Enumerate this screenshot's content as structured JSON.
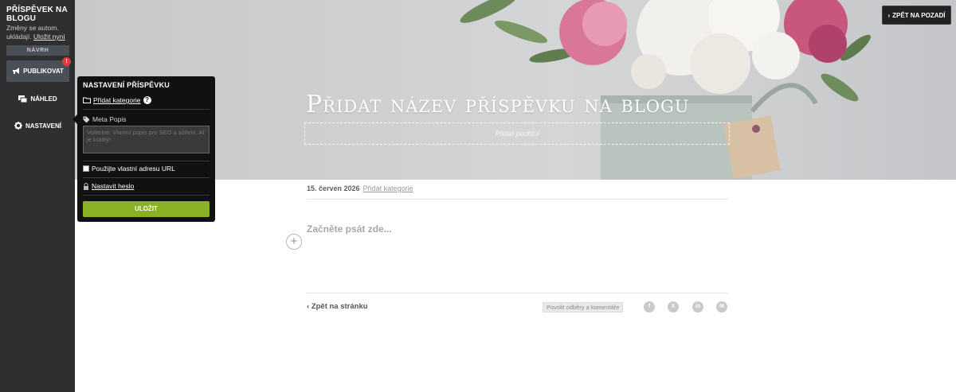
{
  "sidebar": {
    "title": "PŘÍSPĚVEK NA BLOGU",
    "autosave_text": "Změny se autom. ukládají.",
    "save_now_link": "Uložit nyní",
    "draft_label": "NÁVRH",
    "publish_label": "PUBLIKOVAT",
    "publish_badge": "!",
    "preview_label": "NÁHLED",
    "settings_label": "NASTAVENÍ",
    "publish_icon": "megaphone-icon",
    "preview_icon": "preview-icon",
    "settings_icon": "gear-icon"
  },
  "hero": {
    "title": "Přidat název příspěvku na blogu",
    "subtitle_placeholder": "Přidat podtitul",
    "back_button_label": "ZPĚT NA POZADÍ"
  },
  "post": {
    "date": "15. červen 2026",
    "category_link": "Přidat kategorie",
    "start_writing": "Začněte psát zde...",
    "add_block_glyph": "+"
  },
  "footer": {
    "back_link": "Zpět na stránku",
    "subscribe_button": "Povolit odběry a komentáře",
    "share_icons": [
      {
        "name": "facebook-icon",
        "glyph": "f"
      },
      {
        "name": "x-icon",
        "glyph": "X"
      },
      {
        "name": "linkedin-icon",
        "glyph": "in"
      },
      {
        "name": "email-icon",
        "glyph": "✉"
      }
    ]
  },
  "popup": {
    "title": "NASTAVENÍ PŘÍSPĚVKU",
    "add_category": "Přidat kategorie",
    "meta_label": "Meta Popis",
    "meta_placeholder": "Volitelné. Vlastní popis pro SEO a sdílení. Ať je krátký!",
    "custom_url_label": "Použijte vlastní adresu URL",
    "password_link": "Nastavit heslo",
    "save_button": "ULOŽIT"
  },
  "colors": {
    "sidebar_bg": "#2f2f2f",
    "save_green": "#8ab024",
    "badge_red": "#e23a3a"
  }
}
